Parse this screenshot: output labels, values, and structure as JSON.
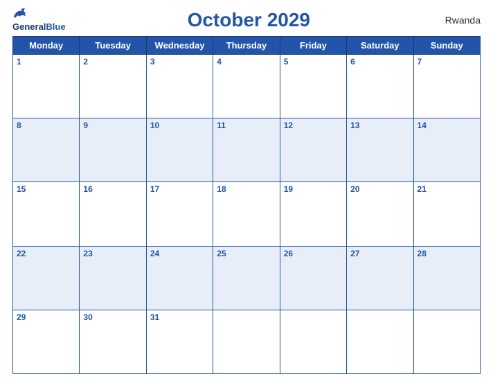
{
  "header": {
    "logo": {
      "line1": "General",
      "line2": "Blue"
    },
    "title": "October 2029",
    "country": "Rwanda"
  },
  "days_of_week": [
    "Monday",
    "Tuesday",
    "Wednesday",
    "Thursday",
    "Friday",
    "Saturday",
    "Sunday"
  ],
  "weeks": [
    [
      1,
      2,
      3,
      4,
      5,
      6,
      7
    ],
    [
      8,
      9,
      10,
      11,
      12,
      13,
      14
    ],
    [
      15,
      16,
      17,
      18,
      19,
      20,
      21
    ],
    [
      22,
      23,
      24,
      25,
      26,
      27,
      28
    ],
    [
      29,
      30,
      31,
      null,
      null,
      null,
      null
    ]
  ],
  "accent_color": "#2255aa"
}
